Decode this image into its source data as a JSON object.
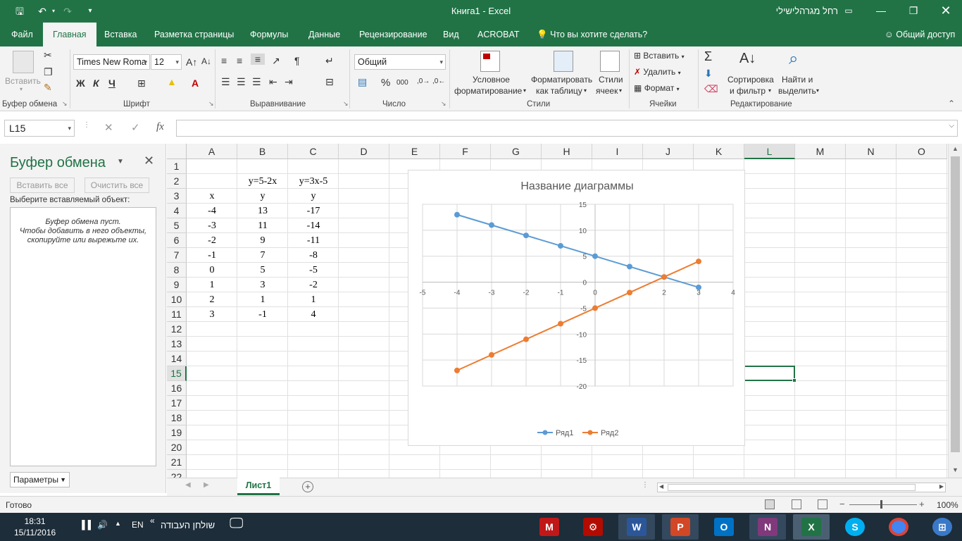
{
  "window": {
    "title": "Книга1  -  Excel",
    "user": "רחל מגרהלישילי"
  },
  "tabs": {
    "file": "Файл",
    "home": "Главная",
    "insert": "Вставка",
    "page_layout": "Разметка страницы",
    "formulas": "Формулы",
    "data": "Данные",
    "review": "Рецензирование",
    "view": "Вид",
    "acrobat": "ACROBAT",
    "tell_me": "Что вы хотите сделать?",
    "share": "Общий доступ"
  },
  "ribbon": {
    "paste_label": "Вставить",
    "clipboard_group": "Буфер обмена",
    "font_name": "Times New Roma",
    "font_size": "12",
    "bold": "Ж",
    "italic": "К",
    "underline": "Ч",
    "font_group": "Шрифт",
    "alignment_group": "Выравнивание",
    "number_format": "Общий",
    "number_group": "Число",
    "percent": "%",
    "thousands": "000",
    "cond_format_1": "Условное",
    "cond_format_2": "форматирование",
    "format_table_1": "Форматировать",
    "format_table_2": "как таблицу",
    "cell_styles_1": "Стили",
    "cell_styles_2": "ячеек",
    "styles_group": "Стили",
    "insert_cells": "Вставить",
    "delete_cells": "Удалить",
    "format_cells": "Формат",
    "cells_group": "Ячейки",
    "sort_filter_1": "Сортировка",
    "sort_filter_2": "и фильтр",
    "find_select_1": "Найти и",
    "find_select_2": "выделить",
    "editing_group": "Редактирование"
  },
  "formula_bar": {
    "name_box": "L15",
    "formula": ""
  },
  "clipboard_pane": {
    "title": "Буфер обмена",
    "paste_all": "Вставить все",
    "clear_all": "Очистить все",
    "select_label": "Выберите вставляемый объект:",
    "empty_line1": "Буфер обмена пуст.",
    "empty_line2": "Чтобы добавить в него объекты,",
    "empty_line3": "скопируйте или вырежьте их.",
    "options": "Параметры"
  },
  "grid": {
    "columns": [
      "A",
      "B",
      "C",
      "D",
      "E",
      "F",
      "G",
      "H",
      "I",
      "J",
      "K",
      "L",
      "M",
      "N",
      "O"
    ],
    "rows": [
      "1",
      "2",
      "3",
      "4",
      "5",
      "6",
      "7",
      "8",
      "9",
      "10",
      "11",
      "12",
      "13",
      "14",
      "15",
      "16",
      "17",
      "18",
      "19",
      "20",
      "21",
      "22"
    ],
    "selected_column": "L",
    "selected_row": "15",
    "cells": {
      "B2": "y=5-2x",
      "C2": "y=3x-5",
      "A3": "x",
      "B3": "y",
      "C3": "y",
      "A4": "-4",
      "B4": "13",
      "C4": "-17",
      "A5": "-3",
      "B5": "11",
      "C5": "-14",
      "A6": "-2",
      "B6": "9",
      "C6": "-11",
      "A7": "-1",
      "B7": "7",
      "C7": "-8",
      "A8": "0",
      "B8": "5",
      "C8": "-5",
      "A9": "1",
      "B9": "3",
      "C9": "-2",
      "A10": "2",
      "B10": "1",
      "C10": "1",
      "A11": "3",
      "B11": "-1",
      "C11": "4"
    }
  },
  "chart_data": {
    "type": "scatter",
    "title": "Название диаграммы",
    "xlabel": "",
    "ylabel": "",
    "xlim": [
      -5,
      4
    ],
    "ylim": [
      -20,
      15
    ],
    "x_ticks": [
      -5,
      -4,
      -3,
      -2,
      -1,
      0,
      1,
      2,
      3,
      4
    ],
    "y_ticks": [
      -20,
      -15,
      -10,
      -5,
      0,
      5,
      10,
      15
    ],
    "grid": true,
    "legend_position": "bottom",
    "series": [
      {
        "name": "Ряд1",
        "color": "#5b9bd5",
        "x": [
          -4,
          -3,
          -2,
          -1,
          0,
          1,
          2,
          3
        ],
        "y": [
          13,
          11,
          9,
          7,
          5,
          3,
          1,
          -1
        ]
      },
      {
        "name": "Ряд2",
        "color": "#ed7d31",
        "x": [
          -4,
          -3,
          -2,
          -1,
          0,
          1,
          2,
          3
        ],
        "y": [
          -17,
          -14,
          -11,
          -8,
          -5,
          -2,
          1,
          4
        ]
      }
    ]
  },
  "sheets": {
    "active": "Лист1"
  },
  "status": {
    "ready": "Готово",
    "zoom": "100%"
  },
  "taskbar": {
    "time": "18:31",
    "date": "15/11/2016",
    "lang": "EN",
    "desktop_label": "שולחן העבודה",
    "chevron": "«"
  },
  "colors": {
    "excel_green": "#217346",
    "series1": "#5b9bd5",
    "series2": "#ed7d31"
  }
}
